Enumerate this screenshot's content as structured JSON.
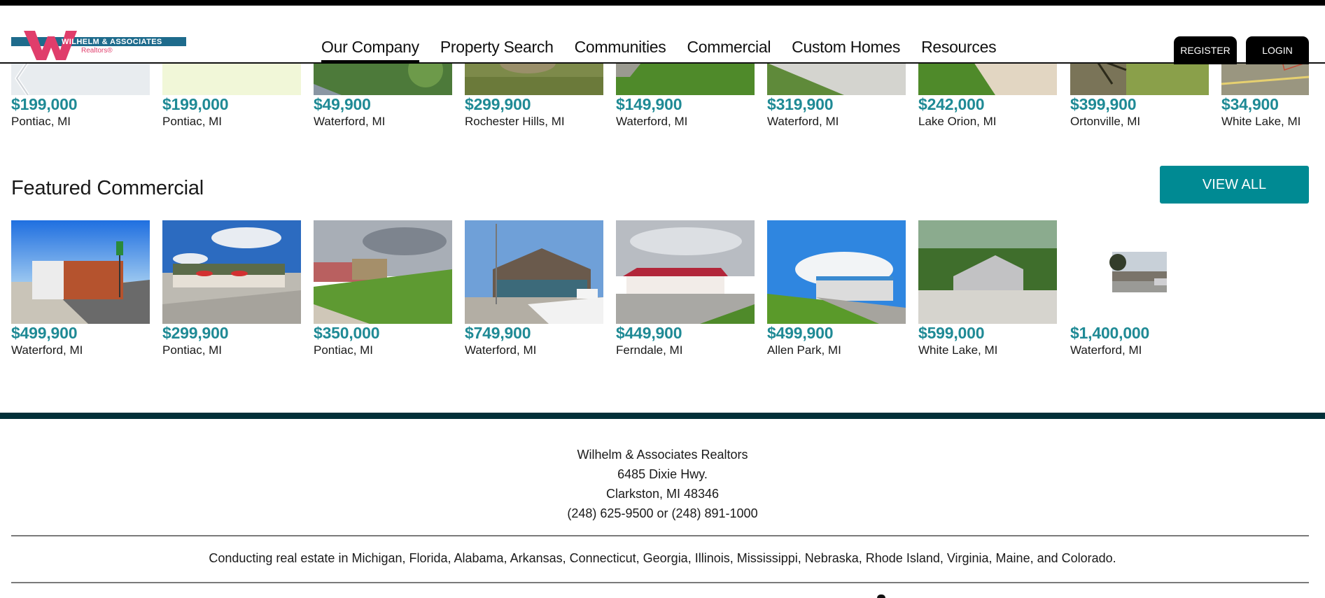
{
  "header": {
    "logo": {
      "name": "WILHELM & ASSOCIATES",
      "sub": "Realtors®"
    },
    "nav": [
      {
        "label": "Our Company",
        "active": true
      },
      {
        "label": "Property Search",
        "active": false
      },
      {
        "label": "Communities",
        "active": false
      },
      {
        "label": "Commercial",
        "active": false
      },
      {
        "label": "Custom Homes",
        "active": false
      },
      {
        "label": "Resources",
        "active": false
      }
    ],
    "register_label": "REGISTER",
    "login_label": "LOGIN"
  },
  "top_listings": [
    {
      "price": "$199,000",
      "location": "Pontiac, MI",
      "photo": "map-placeholder"
    },
    {
      "price": "$199,000",
      "location": "Pontiac, MI",
      "photo": "plat-drawing"
    },
    {
      "price": "$49,900",
      "location": "Waterford, MI",
      "photo": "wooded-lot"
    },
    {
      "price": "$299,900",
      "location": "Rochester Hills, MI",
      "photo": "grass-lot"
    },
    {
      "price": "$149,900",
      "location": "Waterford, MI",
      "photo": "lawn"
    },
    {
      "price": "$319,900",
      "location": "Waterford, MI",
      "photo": "lawn-sidewalk"
    },
    {
      "price": "$242,000",
      "location": "Lake Orion, MI",
      "photo": "driveway"
    },
    {
      "price": "$399,900",
      "location": "Ortonville, MI",
      "photo": "pine-lot"
    },
    {
      "price": "$34,900",
      "location": "White Lake, MI",
      "photo": "aerial-map"
    }
  ],
  "featured_commercial": {
    "title": "Featured Commercial",
    "view_all_label": "VIEW ALL",
    "listings": [
      {
        "price": "$499,900",
        "location": "Waterford, MI",
        "photo": "brick-building"
      },
      {
        "price": "$299,900",
        "location": "Pontiac, MI",
        "photo": "restaurant-patio"
      },
      {
        "price": "$350,000",
        "location": "Pontiac, MI",
        "photo": "grass-strip"
      },
      {
        "price": "$749,900",
        "location": "Waterford, MI",
        "photo": "retail-building"
      },
      {
        "price": "$449,900",
        "location": "Ferndale, MI",
        "photo": "red-roof-building"
      },
      {
        "price": "$499,900",
        "location": "Allen Park, MI",
        "photo": "blue-stripe-building"
      },
      {
        "price": "$599,000",
        "location": "White Lake, MI",
        "photo": "gray-house"
      },
      {
        "price": "$1,400,000",
        "location": "Waterford, MI",
        "photo": "small-thumbnail"
      }
    ]
  },
  "footer": {
    "address_lines": [
      "Wilhelm & Associates Realtors",
      "6485 Dixie Hwy.",
      "Clarkston, MI 48346",
      "(248) 625-9500 or (248) 891-1000"
    ],
    "states_text": "Conducting real estate in Michigan, Florida, Alabama, Arkansas, Connecticut, Georgia, Illinois, Mississippi, Nebraska, Rhode Island, Virginia, Maine, and Colorado."
  },
  "colors": {
    "accent": "#008a93",
    "price": "#1f8a95",
    "footer_bar": "#023038",
    "logo_blue": "#1e6b8c",
    "logo_pink": "#e03d6b"
  }
}
